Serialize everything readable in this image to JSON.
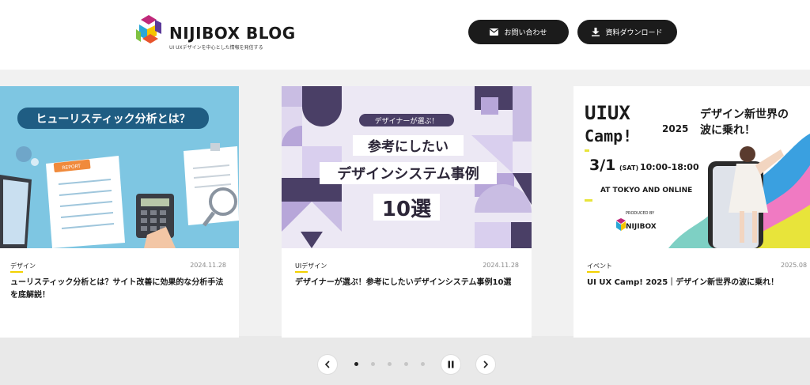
{
  "header": {
    "logo_title": "NIJIBOX BLOG",
    "logo_tagline": "UI UXデザインを中心とした情報を発信する",
    "contact_label": "お問い合わせ",
    "download_label": "資料ダウンロード"
  },
  "cards": [
    {
      "image_text": "ヒューリスティック分析とは？",
      "image_badge": "REPORT",
      "category": "デザイン",
      "date": "2024.11.28",
      "title": "ューリスティック分析とは？サイト改善に効果的な分析手法を底解説！"
    },
    {
      "image_badge": "デザイナーが選ぶ！",
      "image_line1": "参考にしたい",
      "image_line2": "デザインシステム事例",
      "image_line3": "10選",
      "category": "UIデザイン",
      "date": "2024.11.28",
      "title": "デザイナーが選ぶ！参考にしたいデザインシステム事例10選"
    },
    {
      "image_logo_line1": "UIUX",
      "image_logo_line2": "Camp!",
      "image_year": "2025",
      "image_headline1": "デザイン新世界の",
      "image_headline2": "波に乗れ！",
      "image_date_main": "3/1",
      "image_date_sat": "(SAT)",
      "image_time": "10:00-18:00",
      "image_place": "AT TOKYO AND ONLINE",
      "image_produced": "PRODUCED BY",
      "image_producer": "NIJIBOX",
      "category": "イベント",
      "date": "2025.08",
      "title": "UI UX Camp! 2025｜デザイン新世界の波に乗れ！"
    }
  ],
  "controls": {
    "dot_count": 5,
    "active_dot": 0,
    "prev_icon": "chevron-left-icon",
    "next_icon": "chevron-right-icon",
    "pause_icon": "pause-icon"
  },
  "colors": {
    "header_button": "#1b1b1b",
    "category_underline": "#f2d100",
    "card1_bg": "#7ec6e2",
    "card2_bg": "#ece8f4",
    "card2_accent": "#4a3f66",
    "card3_accent": "#e8e43a"
  }
}
